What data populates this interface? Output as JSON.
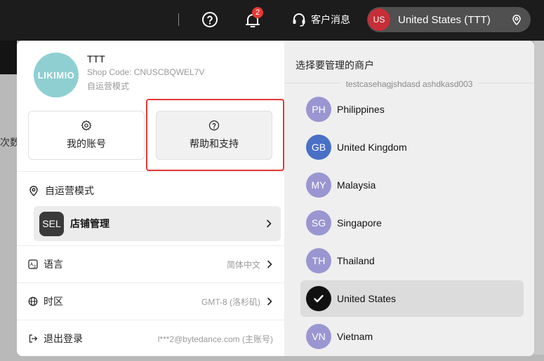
{
  "topbar": {
    "notification_count": "2",
    "messages_label": "客户消息",
    "region_code": "US",
    "region_label": "United States (TTT)"
  },
  "background": {
    "partial_text": "次数"
  },
  "account": {
    "logo_text": "LIKIMIO",
    "shop_name": "TTT",
    "shop_code": "Shop Code: CNUSCBQWEL7V",
    "shop_mode": "自运营模式"
  },
  "cards": {
    "account_label": "我的账号",
    "help_label": "帮助和支持"
  },
  "mode": {
    "label": "自运营模式"
  },
  "store": {
    "avatar": "SEL",
    "label": "店铺管理"
  },
  "settings": {
    "language_label": "语言",
    "language_value": "简体中文",
    "timezone_label": "时区",
    "timezone_value": "GMT-8 (洛杉矶)",
    "logout_label": "退出登录",
    "logout_value": "l***2@bytedance.com (主账号)"
  },
  "merchant": {
    "title": "选择要管理的商户",
    "subtitle": "testcasehagjshdasd ashdkasd003",
    "regions": [
      {
        "code": "PH",
        "name": "Philippines",
        "color": "#9a96d1"
      },
      {
        "code": "GB",
        "name": "United Kingdom",
        "color": "#4a6fc7"
      },
      {
        "code": "MY",
        "name": "Malaysia",
        "color": "#9a96d1"
      },
      {
        "code": "SG",
        "name": "Singapore",
        "color": "#9a96d1"
      },
      {
        "code": "TH",
        "name": "Thailand",
        "color": "#9a96d1"
      },
      {
        "code": "",
        "name": "United States",
        "color": "#111111",
        "selected": true
      },
      {
        "code": "VN",
        "name": "Vietnam",
        "color": "#9a96d1"
      }
    ]
  },
  "colors": {
    "topbar": "#1c1c1c",
    "highlight": "#e53935",
    "badge": "#e53935",
    "region_avatar_bg": "#c62f37"
  }
}
